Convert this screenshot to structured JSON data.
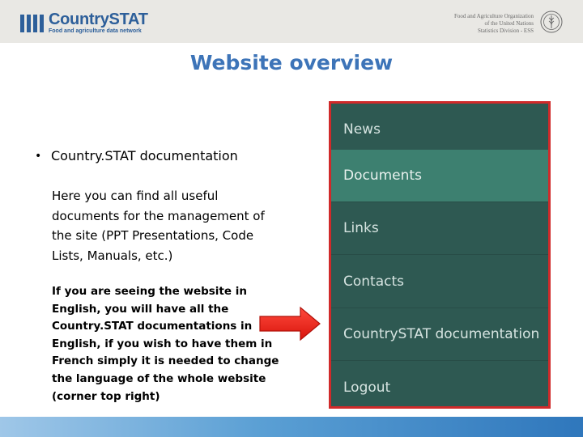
{
  "header": {
    "logo_name": "CountrySTAT",
    "logo_sub": "Food and agriculture data network",
    "fao_lines": [
      "Food and Agriculture Organization",
      "of the United Nations",
      "Statistics Division - ESS"
    ]
  },
  "slide": {
    "title": "Website overview",
    "bullet_heading": "Country.STAT  documentation",
    "body_text": "Here you can find all useful documents for the management of the site (PPT Presentations, Code Lists, Manuals, etc.)",
    "note_text": "If you are seeing the website in English, you will have all the Country.STAT documentations in English, if you wish to have them in French simply it is needed to change the language of the whole website (corner top right)"
  },
  "menu": {
    "items": [
      {
        "label": "News",
        "active": false
      },
      {
        "label": "Documents",
        "active": true
      },
      {
        "label": "Links",
        "active": false
      },
      {
        "label": "Contacts",
        "active": false
      },
      {
        "label": "CountrySTAT documentation",
        "active": false
      },
      {
        "label": "Logout",
        "active": false
      }
    ]
  },
  "colors": {
    "brand_blue": "#2d5f9a",
    "title_blue": "#3d74b8",
    "menu_bg": "#2e5952",
    "menu_active": "#3d8070",
    "highlight_red": "#d02a2a",
    "arrow_red": "#e8201a"
  }
}
